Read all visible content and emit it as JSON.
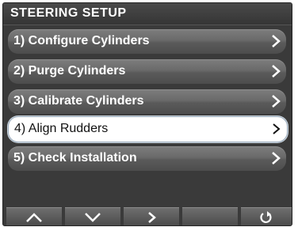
{
  "screen": {
    "title": "STEERING SETUP"
  },
  "menu": {
    "items": [
      {
        "label": "1) Configure Cylinders",
        "selected": false
      },
      {
        "label": "2) Purge Cylinders",
        "selected": false
      },
      {
        "label": "3) Calibrate Cylinders",
        "selected": false
      },
      {
        "label": "4) Align Rudders",
        "selected": true
      },
      {
        "label": "5) Check Installation",
        "selected": false
      }
    ]
  },
  "softkeys": [
    {
      "icon": "chevron-up-icon"
    },
    {
      "icon": "chevron-down-icon"
    },
    {
      "icon": "chevron-right-icon"
    },
    {
      "icon": ""
    },
    {
      "icon": "back-icon"
    }
  ],
  "colors": {
    "screen_bg": "#3a3a3a",
    "item_bg": "#6a6a6a",
    "selected_bg": "#ffffff",
    "text": "#ffffff",
    "selected_text": "#111111"
  }
}
